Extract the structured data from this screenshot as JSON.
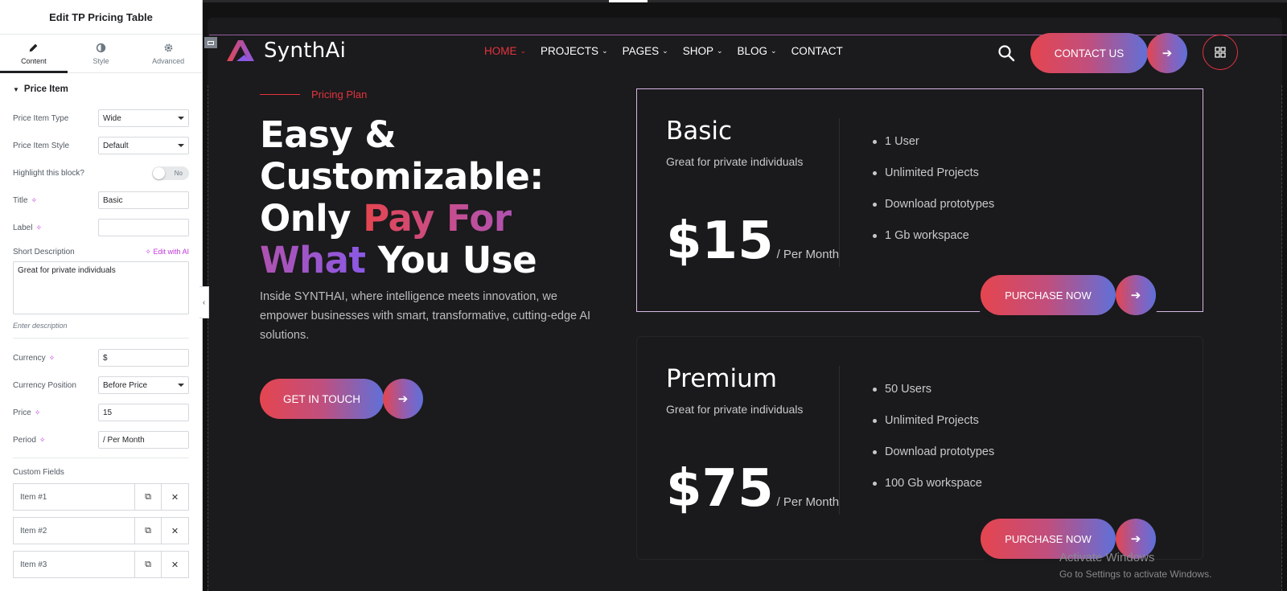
{
  "panel": {
    "title": "Edit TP Pricing Table",
    "tabs": [
      {
        "label": "Content",
        "icon": "pencil-icon"
      },
      {
        "label": "Style",
        "icon": "half-circle-icon"
      },
      {
        "label": "Advanced",
        "icon": "gear-icon"
      }
    ],
    "section_title": "Price Item",
    "fields": {
      "price_item_type": {
        "label": "Price Item Type",
        "value": "Wide"
      },
      "price_item_style": {
        "label": "Price Item Style",
        "value": "Default"
      },
      "highlight": {
        "label": "Highlight this block?",
        "value": "No"
      },
      "title": {
        "label": "Title",
        "value": "Basic"
      },
      "label": {
        "label": "Label",
        "value": ""
      },
      "short_description": {
        "label": "Short Description",
        "ai": "Edit with AI",
        "value": "Great for private individuals",
        "hint": "Enter description"
      },
      "currency": {
        "label": "Currency",
        "value": "$"
      },
      "currency_position": {
        "label": "Currency Position",
        "value": "Before Price"
      },
      "price": {
        "label": "Price",
        "value": "15"
      },
      "period": {
        "label": "Period",
        "value": "/ Per Month"
      }
    },
    "custom_fields_label": "Custom Fields",
    "custom_fields": [
      "Item #1",
      "Item #2",
      "Item #3"
    ]
  },
  "site": {
    "logo": "SynthAi",
    "nav": [
      {
        "label": "HOME",
        "active": true,
        "dropdown": true
      },
      {
        "label": "PROJECTS",
        "active": false,
        "dropdown": true
      },
      {
        "label": "PAGES",
        "active": false,
        "dropdown": true
      },
      {
        "label": "SHOP",
        "active": false,
        "dropdown": true
      },
      {
        "label": "BLOG",
        "active": false,
        "dropdown": true
      },
      {
        "label": "CONTACT",
        "active": false,
        "dropdown": false
      }
    ],
    "contact_button": "CONTACT US"
  },
  "hero": {
    "tagline": "Pricing Plan",
    "headline_1": "Easy & Customizable: Only",
    "headline_grad": "Pay For What",
    "headline_2": "You Use",
    "paragraph": "Inside SYNTHAI, where intelligence meets innovation, we empower businesses with smart, transformative, cutting-edge AI solutions.",
    "cta": "GET IN TOUCH"
  },
  "plans": [
    {
      "title": "Basic",
      "description": "Great for private individuals",
      "price": "$15",
      "period": "/ Per Month",
      "features": [
        "1 User",
        "Unlimited Projects",
        "Download prototypes",
        "1 Gb workspace"
      ],
      "button": "PURCHASE NOW"
    },
    {
      "title": "Premium",
      "description": "Great for private individuals",
      "price": "$75",
      "period": "/ Per Month",
      "features": [
        "50 Users",
        "Unlimited Projects",
        "Download prototypes",
        "100 Gb workspace"
      ],
      "button": "PURCHASE NOW"
    }
  ],
  "watermark": {
    "line1": "Activate Windows",
    "line2": "Go to Settings to activate Windows."
  },
  "colors": {
    "accent": "#e4343f",
    "gradient_start": "#e5454f",
    "gradient_end": "#5f70d9",
    "ai_magenta": "#c036d9"
  }
}
